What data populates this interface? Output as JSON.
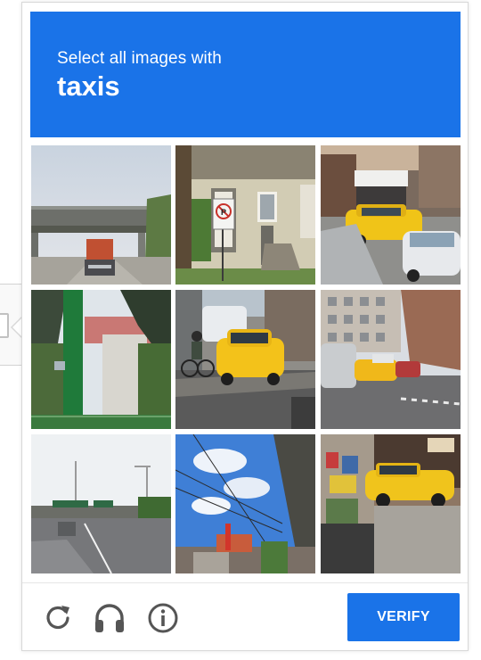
{
  "header": {
    "instruction": "Select all images with",
    "keyword": "taxis",
    "background_color": "#1a73e8"
  },
  "grid": {
    "rows": 3,
    "columns": 3,
    "tiles": [
      {
        "row": 1,
        "column": 1,
        "scene": "highway overpass with truck"
      },
      {
        "row": 1,
        "column": 2,
        "scene": "house with no-parking sign"
      },
      {
        "row": 1,
        "column": 3,
        "scene": "street with yellow taxi"
      },
      {
        "row": 2,
        "column": 1,
        "scene": "green pole and palm trees"
      },
      {
        "row": 2,
        "column": 2,
        "scene": "yellow taxi with cyclist"
      },
      {
        "row": 2,
        "column": 3,
        "scene": "city street with taxis"
      },
      {
        "row": 3,
        "column": 1,
        "scene": "highway under bridge"
      },
      {
        "row": 3,
        "column": 2,
        "scene": "sky with power lines"
      },
      {
        "row": 3,
        "column": 3,
        "scene": "yellow taxi by storefront"
      }
    ]
  },
  "footer": {
    "icons": [
      "reload-icon",
      "headphones-icon",
      "info-icon"
    ],
    "verify_label": "VERIFY",
    "verify_color": "#1a73e8"
  }
}
